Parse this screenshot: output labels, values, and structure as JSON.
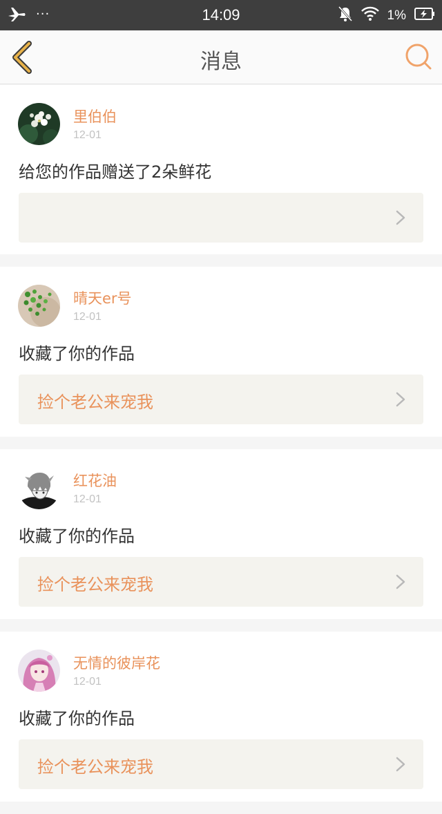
{
  "status_bar": {
    "time": "14:09",
    "dots": "···",
    "battery": "1%",
    "icons": [
      "airplane-icon",
      "bell-off-icon",
      "wifi-icon",
      "battery-charging-icon"
    ]
  },
  "nav": {
    "title": "消息",
    "back_icon": "chevron-left-icon",
    "search_icon": "search-icon",
    "accent": "#e8b24a",
    "search_color": "#f0a36a"
  },
  "colors": {
    "username": "#e9925b",
    "work_title": "#e9925b",
    "date": "#c2c2c2",
    "box_bg": "#f4f3ee"
  },
  "messages": [
    {
      "username": "里伯伯",
      "date": "12-01",
      "action": "给您的作品赠送了2朵鲜花",
      "work_title": ""
    },
    {
      "username": "晴天er号",
      "date": "12-01",
      "action": "收藏了你的作品",
      "work_title": "捡个老公来宠我"
    },
    {
      "username": "红花油",
      "date": "12-01",
      "action": "收藏了你的作品",
      "work_title": "捡个老公来宠我"
    },
    {
      "username": "无情的彼岸花",
      "date": "12-01",
      "action": "收藏了你的作品",
      "work_title": "捡个老公来宠我"
    }
  ]
}
